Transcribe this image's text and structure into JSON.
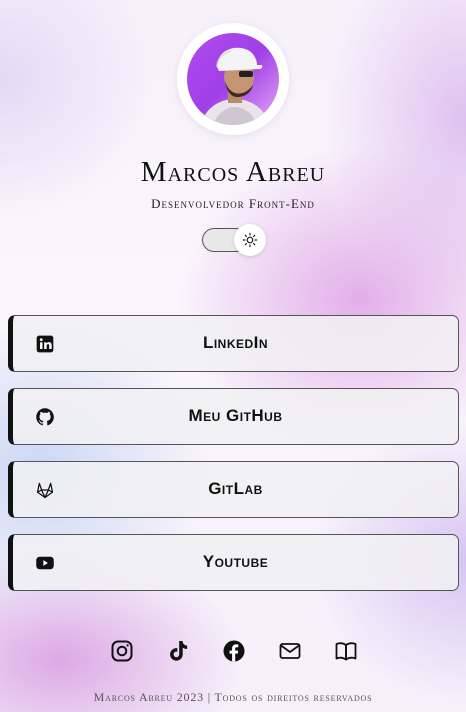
{
  "profile": {
    "name": "Marcos Abreu",
    "role": "Desenvolvedor Front-End"
  },
  "theme_toggle": {
    "icon": "sun-icon",
    "state": "light"
  },
  "links": [
    {
      "label": "LinkedIn",
      "icon": "linkedin-icon"
    },
    {
      "label": "Meu GitHub",
      "icon": "github-icon"
    },
    {
      "label": "GitLab",
      "icon": "gitlab-icon"
    },
    {
      "label": "Youtube",
      "icon": "youtube-icon"
    }
  ],
  "socials": [
    "instagram-icon",
    "tiktok-icon",
    "facebook-icon",
    "email-icon",
    "book-icon"
  ],
  "footer": {
    "text": "Marcos Abreu 2023 | Todos os direitos reservados"
  },
  "colors": {
    "text": "#111111",
    "button_bg": "#f0f0f2",
    "avatar_accent": "#a845ee"
  }
}
